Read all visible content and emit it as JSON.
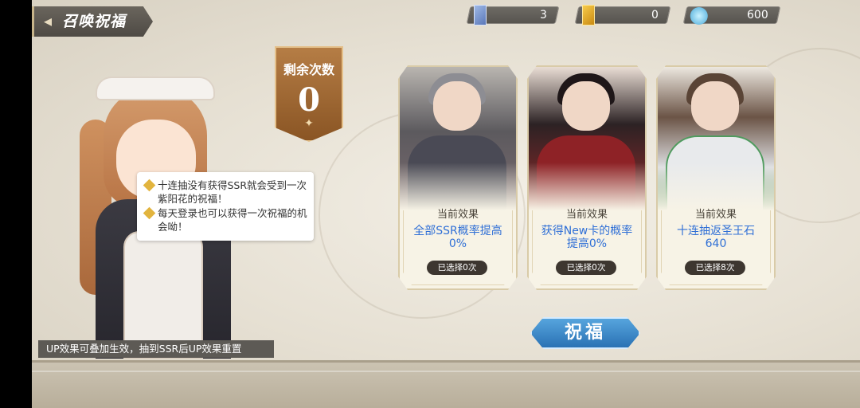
{
  "header": {
    "title": "召唤祝福",
    "back_icon": "back-arrow-icon"
  },
  "currencies": [
    {
      "icon": "blue-ticket-icon",
      "value": "3"
    },
    {
      "icon": "gold-ticket-icon",
      "value": "0"
    },
    {
      "icon": "crystal-gem-icon",
      "value": "600"
    }
  ],
  "remaining": {
    "label": "剩余次数",
    "value": "0"
  },
  "tips": [
    "十连抽没有获得SSR就会受到一次紫阳花的祝福！",
    "每天登录也可以获得一次祝福的机会呦！"
  ],
  "note": "UP效果可叠加生效，抽到SSR后UP效果重置",
  "cards": [
    {
      "label": "当前效果",
      "effect": "全部SSR概率提高0%",
      "count": "已选择0次"
    },
    {
      "label": "当前效果",
      "effect": "获得New卡的概率提高0%",
      "count": "已选择0次"
    },
    {
      "label": "当前效果",
      "effect": "十连抽返圣王石640",
      "count": "已选择8次"
    }
  ],
  "bless_button": "祝福",
  "colors": {
    "accent_blue": "#2f6fd6",
    "button_blue": "#3a86c8",
    "banner_brown": "#a06a35"
  }
}
